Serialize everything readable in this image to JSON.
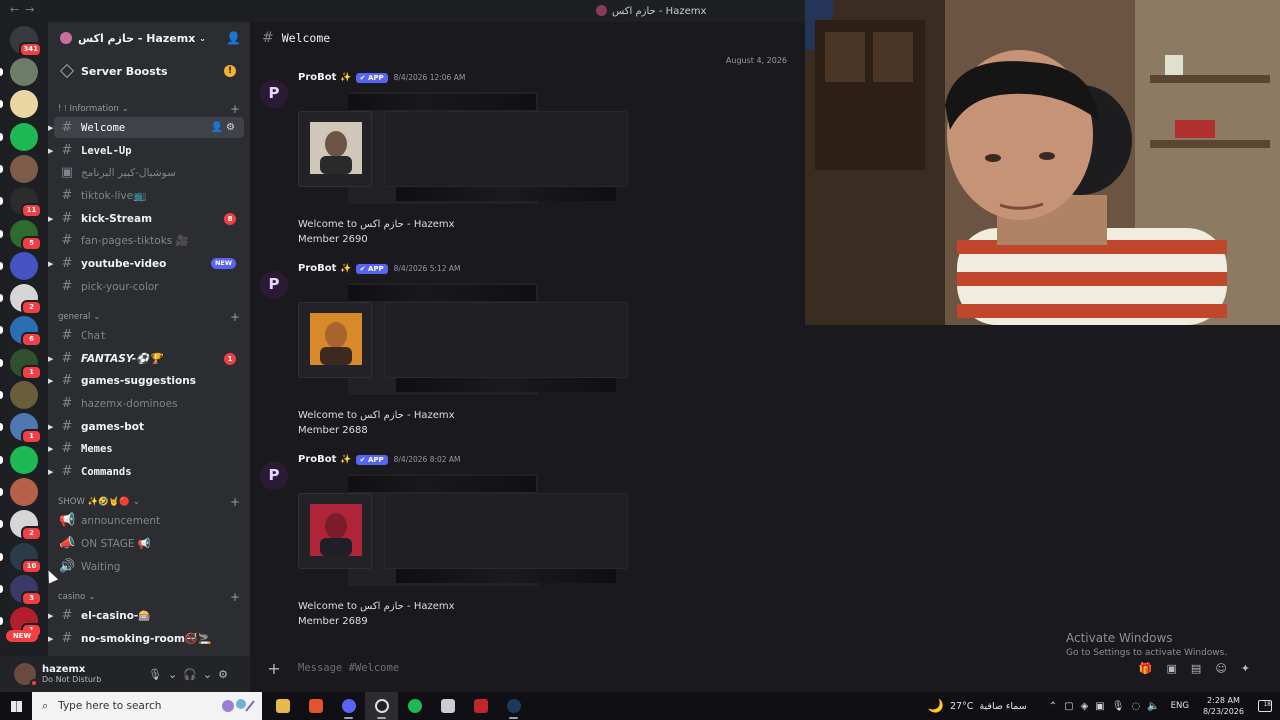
{
  "titlebar": {
    "nav_back": "←",
    "nav_forward": "→",
    "title": "حازم اكس - Hazemx"
  },
  "rail": {
    "dms_badge": "341",
    "servers": [
      {
        "color": "#6e7c6a",
        "badge": ""
      },
      {
        "color": "#e9d7a1",
        "badge": ""
      },
      {
        "color": "#1db954",
        "badge": ""
      },
      {
        "color": "#7d5c4a",
        "badge": ""
      },
      {
        "color": "#2c2c2c",
        "badge": "11"
      },
      {
        "color": "#2f6b2f",
        "badge": "5"
      },
      {
        "color": "#4752c4",
        "badge": ""
      },
      {
        "color": "#d6d6d6",
        "badge": "2"
      },
      {
        "color": "#2b6fb2",
        "badge": "6"
      },
      {
        "color": "#2f4f2f",
        "badge": "1"
      },
      {
        "color": "#6a5d3b",
        "badge": ""
      },
      {
        "color": "#4d78b3",
        "badge": "1"
      },
      {
        "color": "#1db954",
        "badge": ""
      },
      {
        "color": "#b7614a",
        "badge": ""
      },
      {
        "color": "#d6d6d6",
        "badge": "2"
      },
      {
        "color": "#2c3b4a",
        "badge": "10"
      },
      {
        "color": "#3a3a6a",
        "badge": "3"
      },
      {
        "color": "#b11e2c",
        "badge": "1"
      }
    ],
    "new_label": "NEW"
  },
  "guild": {
    "name": "حازم اكس - Hazemx",
    "boosts": "Server Boosts",
    "categories": {
      "information": "! ⁝ Information",
      "general": "general",
      "show": "SHOW ✨🤣🤘🔴",
      "casino": "casino"
    },
    "channels": {
      "welcome": "Welcome",
      "level_up": "LeveL-Up",
      "suggestions_ar": "سوشيال-كبير البرنامج",
      "tiktok_live": "tiktok-live📺",
      "kick_stream": "kick-Stream",
      "fan_pages": "fan-pages-tiktoks 🎥",
      "youtube_video": "youtube-video",
      "pick_color": "pick-your-color",
      "chat": "Chat",
      "fantasy": "FANTASY-⚽🏆",
      "games_suggestions": "games-suggestions",
      "dominoes": "hazemx-dominoes",
      "games_bot": "games-bot",
      "memes": "Memes",
      "commands": "Commands",
      "announcement": "announcement",
      "on_stage": "ON STAGE 📢",
      "waiting": "Waiting",
      "el_casino": "el-casino-🎰",
      "no_smoking": "no-smoking-room🚭🚬"
    },
    "badges": {
      "kick_stream": "8",
      "youtube_video": "NEW",
      "fantasy": "1",
      "boosts_warn": "!"
    }
  },
  "user": {
    "name": "hazemx",
    "status": "Do Not Disturb"
  },
  "chat": {
    "channel": "Welcome",
    "date_divider": "August 4, 2026",
    "composer_placeholder": "Message #Welcome",
    "messages": [
      {
        "author": "ProBot",
        "tag": "APP",
        "time": "8/4/2026 12:06 AM",
        "line1": "Welcome to حازم اكس - Hazemx",
        "line2": "Member 2690"
      },
      {
        "author": "ProBot",
        "tag": "APP",
        "time": "8/4/2026 5:12 AM",
        "line1": "Welcome to حازم اكس - Hazemx",
        "line2": "Member 2688"
      },
      {
        "author": "ProBot",
        "tag": "APP",
        "time": "8/4/2026 8:02 AM",
        "line1": "Welcome to حازم اكس - Hazemx",
        "line2": "Member 2689"
      }
    ]
  },
  "watermark": {
    "line1": "Activate Windows",
    "line2": "Go to Settings to activate Windows."
  },
  "taskbar": {
    "search_placeholder": "Type here to search",
    "weather_temp": "27°C",
    "weather_text": "سماء صافية",
    "lang": "ENG",
    "time": "2:28 AM",
    "date": "8/23/2026",
    "notif_count": "18"
  }
}
